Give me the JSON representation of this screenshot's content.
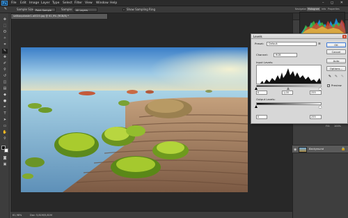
{
  "app": {
    "logo": "Ps",
    "menus": [
      "File",
      "Edit",
      "Image",
      "Layer",
      "Type",
      "Select",
      "Filter",
      "View",
      "Window",
      "Help"
    ],
    "window_buttons": "– ◻ ✕"
  },
  "options_bar": {
    "sample_size_label": "Sample Size:",
    "sample_size_value": "Point Sample",
    "sample_label": "Sample:",
    "sample_value": "All Layers",
    "show_ring_label": "Show Sampling Ring"
  },
  "document": {
    "tab_title": "seitkaqukaste1-a0020.jpg @ 61,9% (RGB/8) *",
    "zoom": "61,98%",
    "doc_info": "Doc: 5,81M/5,81M"
  },
  "panels": {
    "tabs": [
      "Navigator",
      "Histogram",
      "Info",
      "Properties"
    ],
    "active_tab": "Histogram",
    "layer_name": "Background",
    "layers_blend": "Normal",
    "layers_opacity_label": "Opacity:",
    "layers_opacity": "100%",
    "layers_fill_label": "Fill:",
    "layers_fill": "100%"
  },
  "levels": {
    "title": "Levels",
    "close": "✕",
    "preset_label": "Preset:",
    "preset_value": "Default",
    "channel_label": "Channel:",
    "channel_value": "RGB",
    "input_levels_label": "Input Levels:",
    "input_black": "0",
    "input_gamma": "1,00",
    "input_white": "255",
    "output_levels_label": "Output Levels:",
    "output_black": "0",
    "output_white": "255",
    "buttons": {
      "ok": "OK",
      "cancel": "Cancel",
      "auto": "Auto",
      "options": "Options..."
    },
    "preview_label": "Preview",
    "preview_checked": true
  },
  "colors": {
    "accent": "#3b78d8",
    "panel_dark": "#2b2b2b",
    "dialog_bg": "#d7d7d7"
  }
}
